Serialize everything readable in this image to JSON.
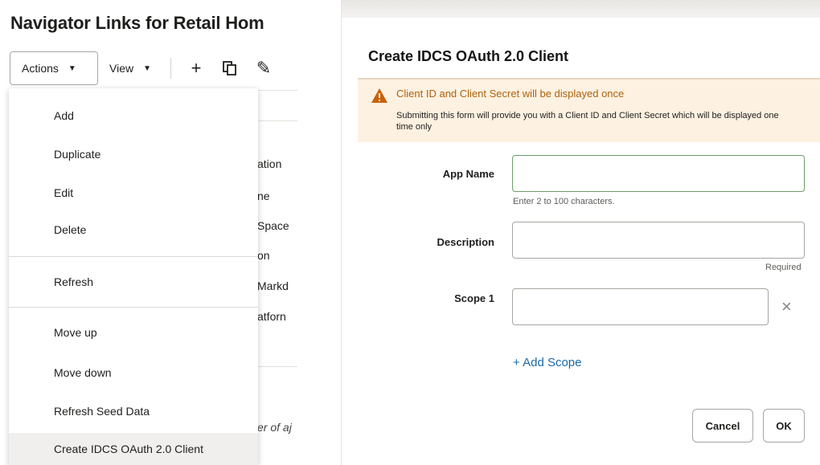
{
  "left": {
    "page_title": "Navigator Links for Retail Hom",
    "toolbar": {
      "actions_label": "Actions",
      "view_label": "View",
      "caret": "▼",
      "add_icon": "+",
      "duplicate_icon": "⧉",
      "edit_icon": "✎"
    },
    "background_rows": [
      "ation",
      "ne",
      "Space",
      "on",
      "Markd",
      "atforn"
    ],
    "background_italic": "er of aj",
    "menu": {
      "items": [
        "Add",
        "Duplicate",
        "Edit",
        "Delete",
        "Refresh",
        "Move up",
        "Move down",
        "Refresh Seed Data",
        "Create IDCS OAuth 2.0 Client"
      ],
      "selected": "Create IDCS OAuth 2.0 Client"
    }
  },
  "dialog": {
    "title": "Create IDCS OAuth 2.0 Client",
    "banner": {
      "heading": "Client ID and Client Secret will be displayed once",
      "body": "Submitting this form will provide you with a Client ID and Client Secret which will be displayed one time only",
      "icon": "warning-icon"
    },
    "fields": {
      "app_name": {
        "label": "App Name",
        "value": "",
        "help": "Enter 2 to 100 characters."
      },
      "description": {
        "label": "Description",
        "value": "",
        "required_text": "Required"
      },
      "scope1": {
        "label": "Scope 1",
        "value": "",
        "clear": "×"
      }
    },
    "add_scope_label": "+ Add Scope",
    "cancel_label": "Cancel",
    "ok_label": "OK"
  },
  "colors": {
    "warning": "#ac630c",
    "banner_bg": "#fdf1e1",
    "link": "#1b6aa8",
    "selected_row": "#f1efed"
  }
}
